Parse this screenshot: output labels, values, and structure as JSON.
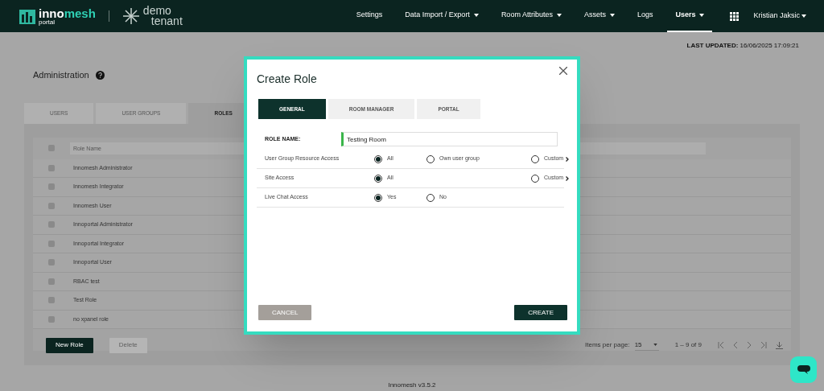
{
  "header": {
    "logo": {
      "word_light": "inno",
      "word_accent": "mesh",
      "subtitle": "portal"
    },
    "tenant": {
      "line_1": "demo",
      "line_2": "tenant"
    },
    "nav": [
      {
        "label": "Settings",
        "has_menu": false,
        "selected": false
      },
      {
        "label": "Data Import / Export",
        "has_menu": true,
        "selected": false
      },
      {
        "label": "Room Attributes",
        "has_menu": true,
        "selected": false
      },
      {
        "label": "Assets",
        "has_menu": true,
        "selected": false
      },
      {
        "label": "Logs",
        "has_menu": false,
        "selected": false
      },
      {
        "label": "Users",
        "has_menu": true,
        "selected": true
      }
    ],
    "user": "Kristian Jaksic"
  },
  "last_updated": {
    "label": "LAST UPDATED:",
    "value": "16/06/2025 17:09:21"
  },
  "page_title": "Administration",
  "tabs": [
    {
      "label": "USERS",
      "selected": false
    },
    {
      "label": "USER GROUPS",
      "selected": false
    },
    {
      "label": "ROLES",
      "selected": true
    }
  ],
  "table": {
    "filter_placeholder": "Role Name",
    "header_checked": false,
    "rows": [
      {
        "name": "Innomesh Administrator",
        "checked": false
      },
      {
        "name": "Innomesh Integrator",
        "checked": false
      },
      {
        "name": "Innomesh User",
        "checked": false
      },
      {
        "name": "Innoportal Administrator",
        "checked": false
      },
      {
        "name": "Innoportal Integrator",
        "checked": false
      },
      {
        "name": "Innoportal User",
        "checked": false
      },
      {
        "name": "RBAC test",
        "checked": false
      },
      {
        "name": "Test Role",
        "checked": false
      },
      {
        "name": "no xpanel role",
        "checked": false
      }
    ]
  },
  "actions": [
    {
      "label": "New Role",
      "disabled": false
    },
    {
      "label": "Delete",
      "disabled": true
    }
  ],
  "pagination": {
    "items_per_page_label": "Items per page:",
    "items_per_page": "15",
    "range": "1 – 9 of 9"
  },
  "footer": "Innomesh v3.5.2",
  "modal": {
    "title": "Create Role",
    "tabs": [
      {
        "label": "GENERAL",
        "selected": true
      },
      {
        "label": "ROOM MANAGER",
        "selected": false
      },
      {
        "label": "PORTAL",
        "selected": false
      }
    ],
    "role_name": {
      "label": "ROLE NAME:",
      "value": "Testing Room"
    },
    "options": [
      {
        "label": "User Group Resource Access",
        "choices": [
          {
            "kind": "option",
            "label": "All",
            "selected": true
          },
          {
            "kind": "option",
            "label": "Own user group",
            "selected": false
          },
          {
            "kind": "custom",
            "label": "Custom",
            "selected": false
          }
        ]
      },
      {
        "label": "Site Access",
        "choices": [
          {
            "kind": "option",
            "label": "All",
            "selected": true
          },
          {
            "kind": "custom",
            "label": "Custom",
            "selected": false
          }
        ]
      },
      {
        "label": "Live Chat Access",
        "choices": [
          {
            "kind": "option",
            "label": "Yes",
            "selected": true
          },
          {
            "kind": "option",
            "label": "No",
            "selected": false
          }
        ]
      }
    ],
    "buttons": [
      {
        "kind": "secondary",
        "label": "CANCEL"
      },
      {
        "kind": "primary",
        "label": "CREATE"
      }
    ]
  }
}
